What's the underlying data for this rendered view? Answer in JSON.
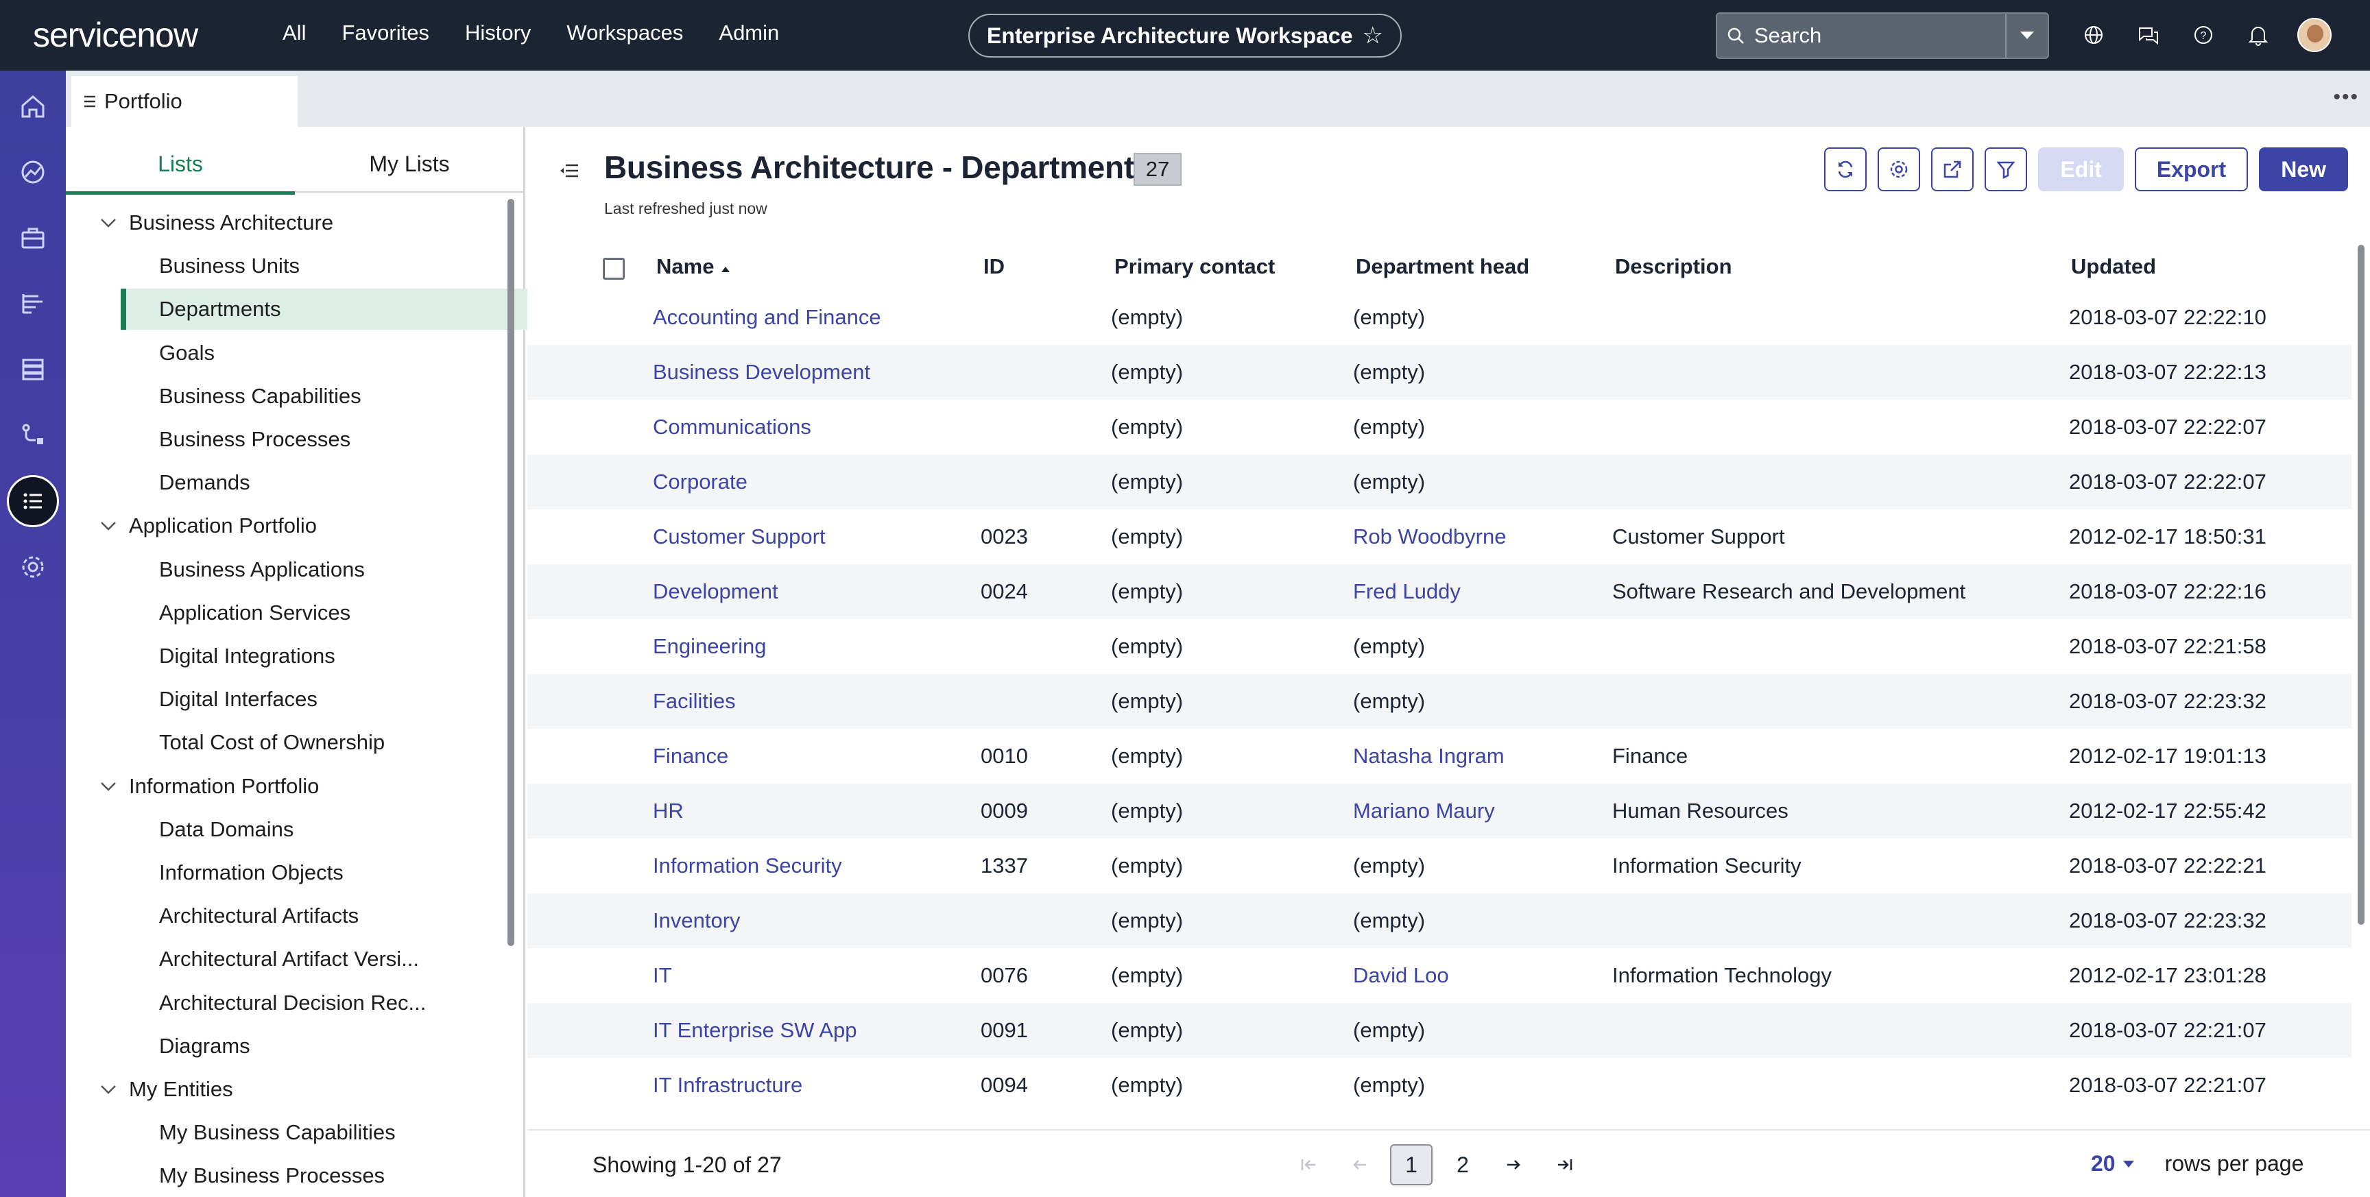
{
  "app": {
    "logo": "servicenow"
  },
  "topnav": [
    "All",
    "Favorites",
    "History",
    "Workspaces",
    "Admin"
  ],
  "workspace": {
    "title": "Enterprise Architecture Workspace"
  },
  "search": {
    "placeholder": "Search"
  },
  "tabs": {
    "portfolio": "Portfolio"
  },
  "side": {
    "tab_lists": "Lists",
    "tab_my_lists": "My Lists",
    "tree": [
      {
        "type": "group",
        "label": "Business Architecture"
      },
      {
        "type": "item",
        "label": "Business Units"
      },
      {
        "type": "item",
        "label": "Departments",
        "selected": true
      },
      {
        "type": "item",
        "label": "Goals"
      },
      {
        "type": "item",
        "label": "Business Capabilities"
      },
      {
        "type": "item",
        "label": "Business Processes"
      },
      {
        "type": "item",
        "label": "Demands"
      },
      {
        "type": "group",
        "label": "Application Portfolio"
      },
      {
        "type": "item",
        "label": "Business Applications"
      },
      {
        "type": "item",
        "label": "Application Services"
      },
      {
        "type": "item",
        "label": "Digital Integrations"
      },
      {
        "type": "item",
        "label": "Digital Interfaces"
      },
      {
        "type": "item",
        "label": "Total Cost of Ownership"
      },
      {
        "type": "group",
        "label": "Information Portfolio"
      },
      {
        "type": "item",
        "label": "Data Domains"
      },
      {
        "type": "item",
        "label": "Information Objects"
      },
      {
        "type": "item",
        "label": "Architectural Artifacts"
      },
      {
        "type": "item",
        "label": "Architectural Artifact Versi..."
      },
      {
        "type": "item",
        "label": "Architectural Decision Rec..."
      },
      {
        "type": "item",
        "label": "Diagrams"
      },
      {
        "type": "group",
        "label": "My Entities"
      },
      {
        "type": "item",
        "label": "My Business Capabilities"
      },
      {
        "type": "item",
        "label": "My Business Processes"
      }
    ]
  },
  "main": {
    "title": "Business Architecture - Departments",
    "count": "27",
    "refreshed": "Last refreshed just now",
    "buttons": {
      "edit": "Edit",
      "export": "Export",
      "new": "New"
    },
    "columns": [
      "Name",
      "ID",
      "Primary contact",
      "Department head",
      "Description",
      "Updated"
    ],
    "rows": [
      {
        "name": "Accounting and Finance",
        "id": "",
        "contact": "(empty)",
        "head": "(empty)",
        "head_link": false,
        "desc": "",
        "updated": "2018-03-07 22:22:10"
      },
      {
        "name": "Business Development",
        "id": "",
        "contact": "(empty)",
        "head": "(empty)",
        "head_link": false,
        "desc": "",
        "updated": "2018-03-07 22:22:13"
      },
      {
        "name": "Communications",
        "id": "",
        "contact": "(empty)",
        "head": "(empty)",
        "head_link": false,
        "desc": "",
        "updated": "2018-03-07 22:22:07"
      },
      {
        "name": "Corporate",
        "id": "",
        "contact": "(empty)",
        "head": "(empty)",
        "head_link": false,
        "desc": "",
        "updated": "2018-03-07 22:22:07"
      },
      {
        "name": "Customer Support",
        "id": "0023",
        "contact": "(empty)",
        "head": "Rob Woodbyrne",
        "head_link": true,
        "desc": "Customer Support",
        "updated": "2012-02-17 18:50:31"
      },
      {
        "name": "Development",
        "id": "0024",
        "contact": "(empty)",
        "head": "Fred Luddy",
        "head_link": true,
        "desc": "Software Research and Development",
        "updated": "2018-03-07 22:22:16"
      },
      {
        "name": "Engineering",
        "id": "",
        "contact": "(empty)",
        "head": "(empty)",
        "head_link": false,
        "desc": "",
        "updated": "2018-03-07 22:21:58"
      },
      {
        "name": "Facilities",
        "id": "",
        "contact": "(empty)",
        "head": "(empty)",
        "head_link": false,
        "desc": "",
        "updated": "2018-03-07 22:23:32"
      },
      {
        "name": "Finance",
        "id": "0010",
        "contact": "(empty)",
        "head": "Natasha Ingram",
        "head_link": true,
        "desc": "Finance",
        "updated": "2012-02-17 19:01:13"
      },
      {
        "name": "HR",
        "id": "0009",
        "contact": "(empty)",
        "head": "Mariano Maury",
        "head_link": true,
        "desc": "Human Resources",
        "updated": "2012-02-17 22:55:42"
      },
      {
        "name": "Information Security",
        "id": "1337",
        "contact": "(empty)",
        "head": "(empty)",
        "head_link": false,
        "desc": "Information Security",
        "updated": "2018-03-07 22:22:21"
      },
      {
        "name": "Inventory",
        "id": "",
        "contact": "(empty)",
        "head": "(empty)",
        "head_link": false,
        "desc": "",
        "updated": "2018-03-07 22:23:32"
      },
      {
        "name": "IT",
        "id": "0076",
        "contact": "(empty)",
        "head": "David Loo",
        "head_link": true,
        "desc": "Information Technology",
        "updated": "2012-02-17 23:01:28"
      },
      {
        "name": "IT Enterprise SW App",
        "id": "0091",
        "contact": "(empty)",
        "head": "(empty)",
        "head_link": false,
        "desc": "",
        "updated": "2018-03-07 22:21:07"
      },
      {
        "name": "IT Infrastructure",
        "id": "0094",
        "contact": "(empty)",
        "head": "(empty)",
        "head_link": false,
        "desc": "",
        "updated": "2018-03-07 22:21:07"
      }
    ],
    "footer": {
      "showing": "Showing 1-20 of 27",
      "pages": [
        "1",
        "2"
      ],
      "current_page": "1",
      "rows_per_page": "20",
      "rows_per_page_label": "rows per page"
    }
  },
  "colors": {
    "topbar": "#1c2433",
    "accent": "#3c44a6",
    "green": "#1a7d55",
    "logo_dot": "#62d84e"
  }
}
